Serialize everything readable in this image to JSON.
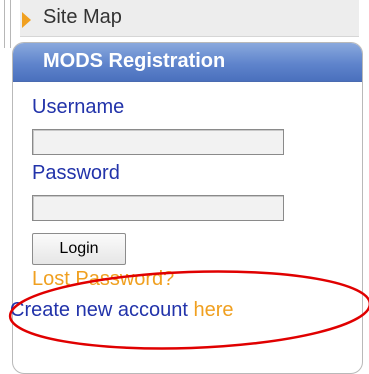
{
  "nav": {
    "site_map_label": "Site Map",
    "arrow_icon": "arrow-right-icon"
  },
  "login_panel": {
    "title": "MODS Registration",
    "username_label": "Username",
    "username_value": "",
    "password_label": "Password",
    "password_value": "",
    "login_button_label": "Login",
    "lost_password_link": "Lost Password?",
    "create_account_text": "Create new account",
    "create_account_link": "here"
  },
  "colors": {
    "header_blue": "#5f84cc",
    "label_blue": "#2233aa",
    "link_orange": "#f0a020",
    "annotation_red": "#e00000"
  }
}
